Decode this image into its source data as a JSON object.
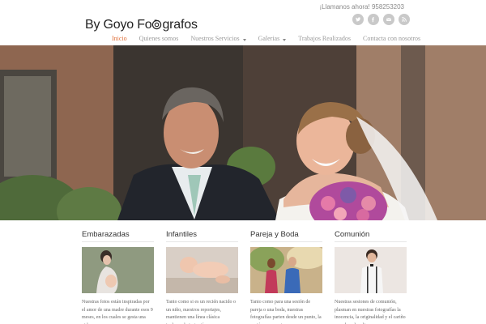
{
  "header": {
    "logo_text_1": "By Goyo Fo",
    "logo_text_2": "grafos",
    "call_text": "¡Llamanos ahora! 958253203",
    "social": [
      "twitter-icon",
      "facebook-icon",
      "email-icon",
      "rss-icon"
    ]
  },
  "nav": {
    "items": [
      {
        "label": "Inicio",
        "active": true,
        "dropdown": false
      },
      {
        "label": "Quienes somos",
        "active": false,
        "dropdown": false
      },
      {
        "label": "Nuestros Servicios",
        "active": false,
        "dropdown": true
      },
      {
        "label": "Galerias",
        "active": false,
        "dropdown": true
      },
      {
        "label": "Trabajos Realizados",
        "active": false,
        "dropdown": false
      },
      {
        "label": "Contacta con nosotros",
        "active": false,
        "dropdown": false
      }
    ]
  },
  "sections": [
    {
      "title": "Embarazadas",
      "text": "Nuestras fotos están inspiradas por el amor de una madre durante esos 9 meses, en los cuales se gesta una vida en su"
    },
    {
      "title": "Infantiles",
      "text": "Tanto como si es un recién nacido o un niño, nuestros reportajes, mantienen una línea clásica incluyendo instantáneas"
    },
    {
      "title": "Pareja y Boda",
      "text": "Tanto como para una sesión de pareja o una boda, nuestras fotografías parten desde un punto, la pasión por nuestro"
    },
    {
      "title": "Comunión",
      "text": "Nuestras sesiones de comunión, plasman en nuestras fotografías la inocencia, la originalidad y el cariño con el cual realizamos"
    }
  ],
  "colors": {
    "accent": "#e0703a",
    "nav": "#9a9a9a",
    "social": "#c9c9c9"
  }
}
